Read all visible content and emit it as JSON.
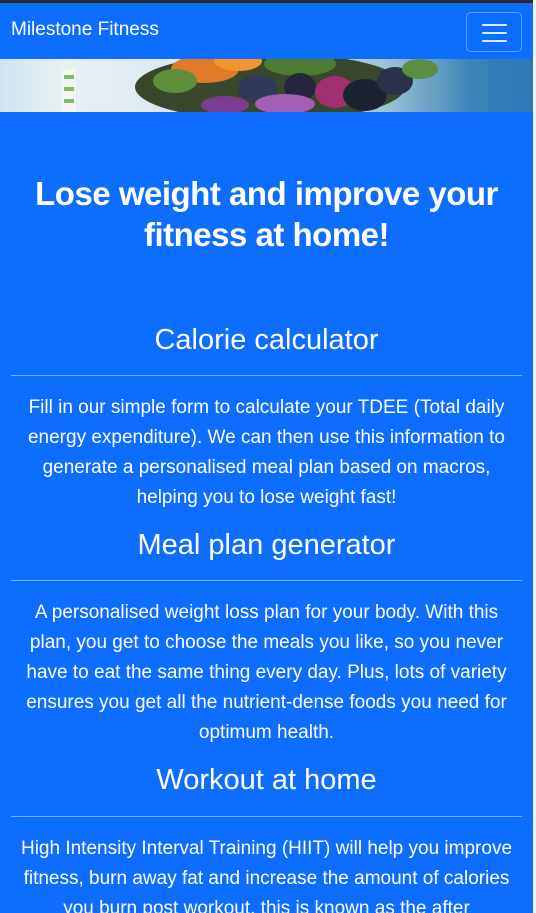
{
  "navbar": {
    "brand": "Milestone Fitness",
    "toggler_icon": "hamburger-menu-icon"
  },
  "hero": {
    "image_subject": "healthy-food-banner"
  },
  "main": {
    "headline": "Lose weight and improve your fitness at home!",
    "sections": [
      {
        "title": "Calorie calculator",
        "text": "Fill in our simple form to calculate your TDEE (Total daily energy expenditure). We can then use this information to generate a personalised meal plan based on macros, helping you to lose weight fast!"
      },
      {
        "title": "Meal plan generator",
        "text": "A personalised weight loss plan for your body. With this plan, you get to choose the meals you like, so you never have to eat the same thing every day. Plus, lots of variety ensures you get all the nutrient-dense foods you need for optimum health."
      },
      {
        "title": "Workout at home",
        "text": "High Intensity Interval Training (HIIT) will help you improve fitness, burn away fat and increase the amount of calories you burn post workout, this is known as the after"
      }
    ]
  },
  "colors": {
    "primary": "#0d6efd",
    "text": "#ffffff"
  }
}
